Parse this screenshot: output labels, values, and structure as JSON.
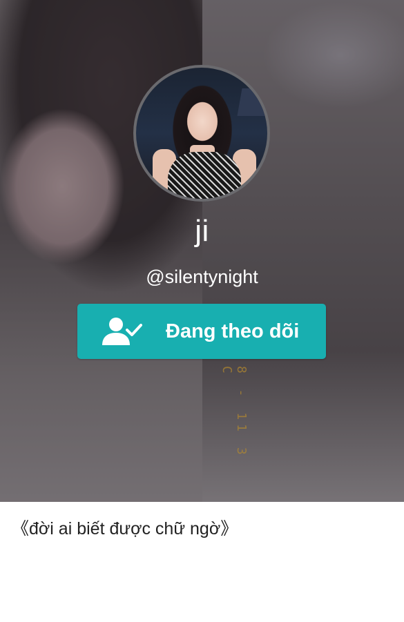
{
  "profile": {
    "display_name": "ji",
    "handle": "@silentynight",
    "bio": "《đời ai biết được chữ ngờ》"
  },
  "follow_button": {
    "label": "Đang theo dõi",
    "icon": "user-check-icon",
    "color": "#18afb0"
  },
  "hero": {
    "film_mark": "8 - 11 3 C",
    "film_mark_color": "#b58a2e"
  }
}
